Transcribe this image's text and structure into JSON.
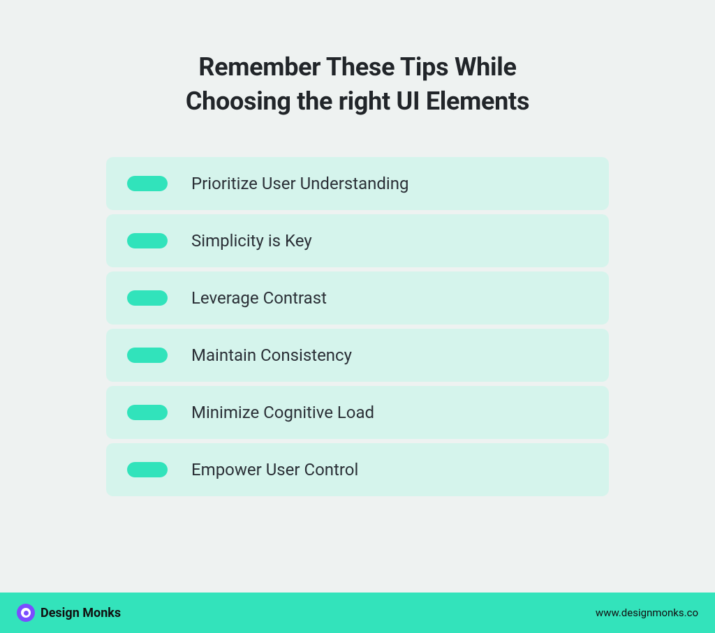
{
  "heading_line1": "Remember These Tips While",
  "heading_line2": "Choosing the right UI Elements",
  "tips": [
    {
      "label": "Prioritize User Understanding"
    },
    {
      "label": "Simplicity is Key"
    },
    {
      "label": "Leverage Contrast"
    },
    {
      "label": "Maintain Consistency"
    },
    {
      "label": "Minimize Cognitive Load"
    },
    {
      "label": "Empower User Control"
    }
  ],
  "footer": {
    "brand": "Design Monks",
    "url": "www.designmonks.co"
  }
}
